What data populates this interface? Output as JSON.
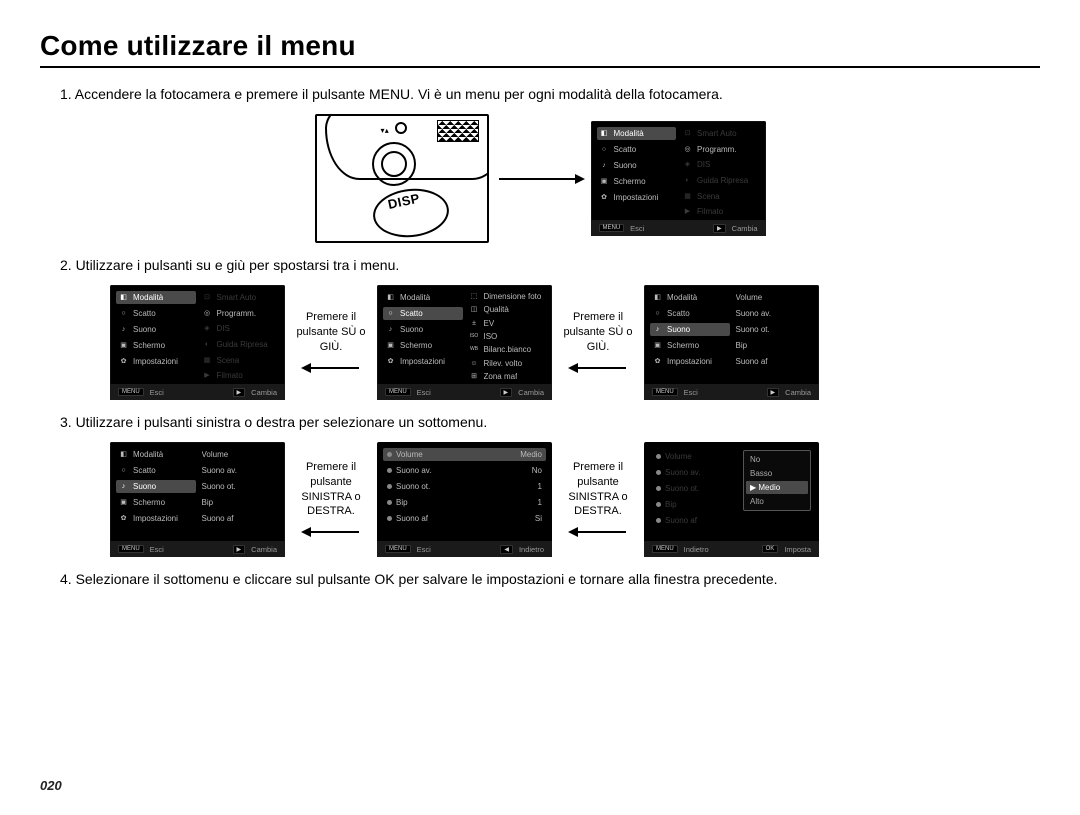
{
  "title": "Come utilizzare il menu",
  "page_number": "020",
  "camera_label": "DISP",
  "steps": {
    "s1": "1. Accendere la fotocamera e premere il pulsante MENU. Vi è un menu per ogni modalità della fotocamera.",
    "s2": "2. Utilizzare i pulsanti su e giù per spostarsi tra i menu.",
    "s3": "3. Utilizzare i pulsanti sinistra o destra per selezionare un sottomenu.",
    "s4": "4. Selezionare il sottomenu e cliccare sul pulsante OK per salvare le impostazioni e tornare alla finestra precedente."
  },
  "captions": {
    "updown": "Premere il pulsante SÙ o GIÙ.",
    "leftright": "Premere il pulsante SINISTRA  o DESTRA."
  },
  "footer": {
    "menu": "MENU",
    "esci": "Esci",
    "play": "▶",
    "left": "◀",
    "ok": "OK",
    "cambia": "Cambia",
    "indietro": "Indietro",
    "imposta": "Imposta"
  },
  "menu_main": {
    "left": [
      {
        "icon": "◧",
        "label": "Modalità"
      },
      {
        "icon": "○",
        "label": "Scatto"
      },
      {
        "icon": "♪",
        "label": "Suono"
      },
      {
        "icon": "▣",
        "label": "Schermo"
      },
      {
        "icon": "✿",
        "label": "Impostazioni"
      }
    ],
    "right": [
      {
        "icon": "⊡",
        "label": "Smart Auto"
      },
      {
        "icon": "◎",
        "label": "Programm."
      },
      {
        "icon": "◈",
        "label": "DIS"
      },
      {
        "icon": "◐",
        "label": "Guida Ripresa"
      },
      {
        "icon": "▦",
        "label": "Scena"
      },
      {
        "icon": "▶",
        "label": "Filmato"
      }
    ]
  },
  "menu_scatto": {
    "left": [
      {
        "icon": "◧",
        "label": "Modalità"
      },
      {
        "icon": "○",
        "label": "Scatto"
      },
      {
        "icon": "♪",
        "label": "Suono"
      },
      {
        "icon": "▣",
        "label": "Schermo"
      },
      {
        "icon": "✿",
        "label": "Impostazioni"
      }
    ],
    "right": [
      {
        "icon": "⬚",
        "label": "Dimensione foto"
      },
      {
        "icon": "◫",
        "label": "Qualità"
      },
      {
        "icon": "±",
        "label": "EV"
      },
      {
        "icon": "ISO",
        "label": "ISO"
      },
      {
        "icon": "WB",
        "label": "Bilanc.bianco"
      },
      {
        "icon": "☺",
        "label": "Rilev. volto"
      },
      {
        "icon": "⊞",
        "label": "Zona maf"
      }
    ]
  },
  "menu_suono": {
    "left": [
      {
        "icon": "◧",
        "label": "Modalità"
      },
      {
        "icon": "○",
        "label": "Scatto"
      },
      {
        "icon": "♪",
        "label": "Suono"
      },
      {
        "icon": "▣",
        "label": "Schermo"
      },
      {
        "icon": "✿",
        "label": "Impostazioni"
      }
    ],
    "right": [
      {
        "label": "Volume"
      },
      {
        "label": "Suono av."
      },
      {
        "label": "Suono ot."
      },
      {
        "label": "Bip"
      },
      {
        "label": "Suono af"
      }
    ]
  },
  "menu_suono_vals": [
    {
      "label": "Volume",
      "val": ""
    },
    {
      "label": "Suono av.",
      "val": ""
    },
    {
      "label": "Suono ot.",
      "val": ""
    },
    {
      "label": "Bip",
      "val": ""
    },
    {
      "label": "Suono af",
      "val": ""
    }
  ],
  "menu_suono_detail": [
    {
      "label": "Volume",
      "val": "Medio"
    },
    {
      "label": "Suono av.",
      "val": "No"
    },
    {
      "label": "Suono ot.",
      "val": "1"
    },
    {
      "label": "Bip",
      "val": "1"
    },
    {
      "label": "Suono af",
      "val": "Si"
    }
  ],
  "popup": {
    "side": [
      "Volume",
      "Suono av.",
      "Suono ot.",
      "Bip",
      "Suono af"
    ],
    "options": [
      "No",
      "Basso",
      "Medio",
      "Alto"
    ],
    "selected": "Medio"
  }
}
